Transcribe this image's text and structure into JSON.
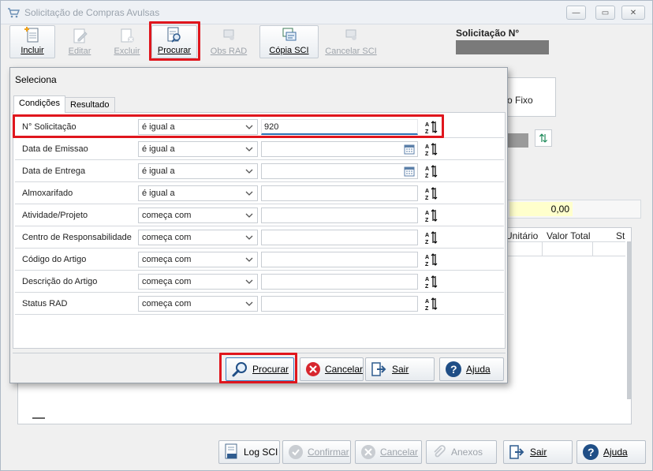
{
  "window": {
    "title": "Solicitação de Compras Avulsas",
    "minimize": "—",
    "maximize": "▭",
    "close": "✕"
  },
  "toolbar": {
    "incluir": "Incluir",
    "editar": "Editar",
    "excluir": "Excluir",
    "procurar": "Procurar",
    "obs_rad": "Obs RAD",
    "copia_sci": "Cópia SCI",
    "cancelar_sci": "Cancelar SCI"
  },
  "header": {
    "solicitacao_label": "Solicitação N°"
  },
  "background": {
    "fixo_label": "vo Fixo",
    "total_value": "0,00",
    "columns": [
      "Unitário",
      "Valor Total",
      "St"
    ]
  },
  "dialog": {
    "title": "Seleciona",
    "tabs": [
      "Condições",
      "Resultado"
    ],
    "rows": [
      {
        "field": "N° Solicitação",
        "operator": "é igual a",
        "value": "920"
      },
      {
        "field": "Data de Emissao",
        "operator": "é igual a",
        "value": ""
      },
      {
        "field": "Data de Entrega",
        "operator": "é igual a",
        "value": ""
      },
      {
        "field": "Almoxarifado",
        "operator": "é igual a",
        "value": ""
      },
      {
        "field": "Atividade/Projeto",
        "operator": "começa com",
        "value": ""
      },
      {
        "field": "Centro de Responsabilidade",
        "operator": "começa com",
        "value": ""
      },
      {
        "field": "Código do Artigo",
        "operator": "começa com",
        "value": ""
      },
      {
        "field": "Descrição do Artigo",
        "operator": "começa com",
        "value": ""
      },
      {
        "field": "Status RAD",
        "operator": "começa com",
        "value": ""
      }
    ],
    "buttons": {
      "procurar": "Procurar",
      "cancelar": "Cancelar",
      "sair": "Sair",
      "ajuda": "Ajuda"
    }
  },
  "footer": {
    "log_sci": "Log SCI",
    "confirmar": "Confirmar",
    "cancelar": "Cancelar",
    "anexos": "Anexos",
    "sair": "Sair",
    "ajuda": "Ajuda"
  },
  "colors": {
    "highlight": "#e0161d",
    "accent": "#2c6fb3",
    "total_bg": "#ffffcc"
  }
}
